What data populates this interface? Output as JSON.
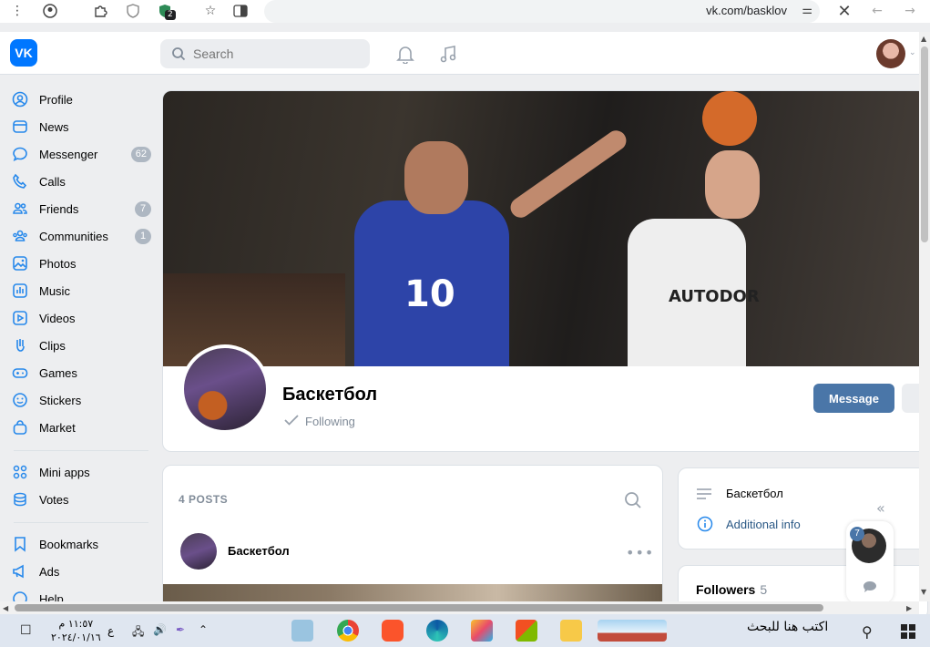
{
  "browser": {
    "url": "vk.com/basklov",
    "extension_badge": "2"
  },
  "header": {
    "logo_text": "VK",
    "search_placeholder": "Search"
  },
  "sidebar": {
    "items": [
      {
        "label": "Profile",
        "icon": "user-circle-icon"
      },
      {
        "label": "News",
        "icon": "news-icon"
      },
      {
        "label": "Messenger",
        "icon": "message-icon",
        "count": "62"
      },
      {
        "label": "Calls",
        "icon": "phone-icon"
      },
      {
        "label": "Friends",
        "icon": "friends-icon",
        "count": "7"
      },
      {
        "label": "Communities",
        "icon": "communities-icon",
        "count": "1"
      },
      {
        "label": "Photos",
        "icon": "photo-icon"
      },
      {
        "label": "Music",
        "icon": "music-icon"
      },
      {
        "label": "Videos",
        "icon": "video-icon"
      },
      {
        "label": "Clips",
        "icon": "clips-icon"
      },
      {
        "label": "Games",
        "icon": "gamepad-icon"
      },
      {
        "label": "Stickers",
        "icon": "smile-icon"
      },
      {
        "label": "Market",
        "icon": "bag-icon"
      },
      {
        "label": "Mini apps",
        "icon": "grid-icon"
      },
      {
        "label": "Votes",
        "icon": "coins-icon"
      },
      {
        "label": "Bookmarks",
        "icon": "bookmark-icon"
      },
      {
        "label": "Ads",
        "icon": "megaphone-icon"
      },
      {
        "label": "Help",
        "icon": "help-icon"
      }
    ]
  },
  "profile": {
    "name": "Баскетбол",
    "following_label": "Following",
    "message_button": "Message",
    "cover_number": "10",
    "cover_jersey_text": "AUTODOR"
  },
  "posts": {
    "header": "4 POSTS",
    "first_author": "Баскетбол"
  },
  "info": {
    "title": "Баскетбол",
    "additional_info": "Additional info"
  },
  "followers": {
    "label": "Followers",
    "count": "5"
  },
  "chat": {
    "badge": "7"
  },
  "taskbar": {
    "search_text": "اكتب هنا للبحث",
    "time": "١١:٥٧ م",
    "date": "٢٠٢٤/٠١/١٦",
    "lang": "ع"
  },
  "colors": {
    "vk_blue": "#0077ff",
    "button_blue": "#4a76a8",
    "badge_gray": "#aeb7c2"
  }
}
